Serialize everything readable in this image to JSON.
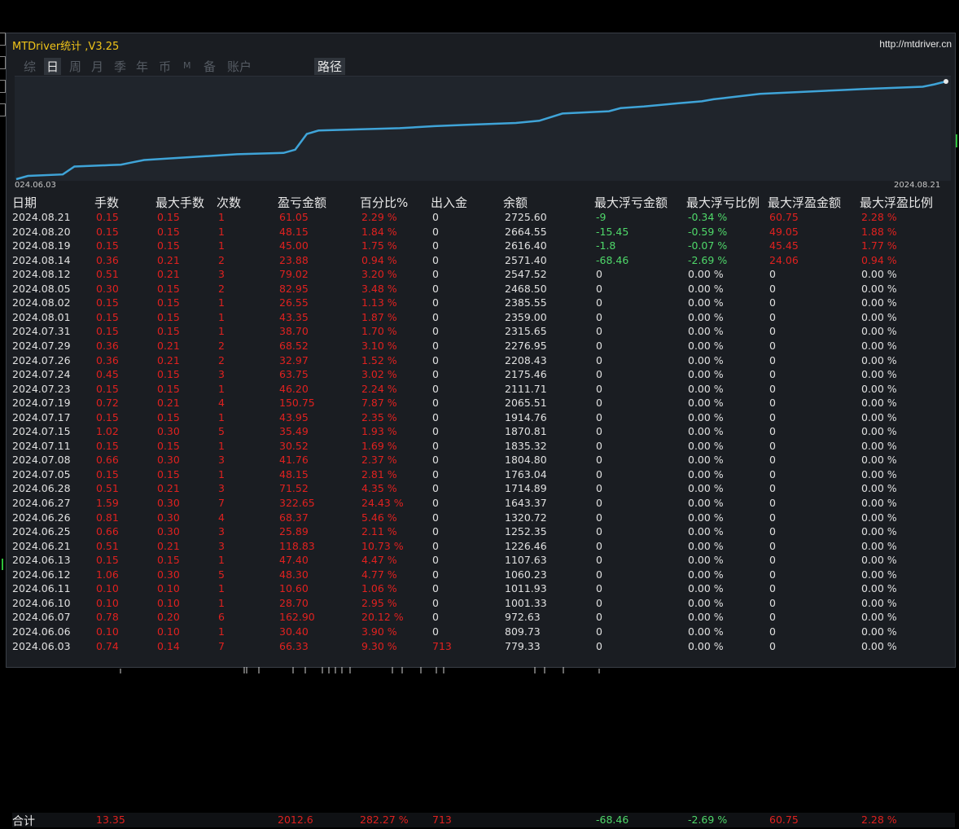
{
  "app": {
    "title": "MTDriver统计 ,V3.25",
    "url": "http://mtdriver.cn"
  },
  "tabs": [
    "综",
    "日",
    "周",
    "月",
    "季",
    "年",
    "币",
    "M",
    "备",
    "账户",
    "路径"
  ],
  "active_tab": "日",
  "chart": {
    "start_date": "024.06.03",
    "end_date": "2024.08.21",
    "line_color": "#3fa4d8"
  },
  "columns": [
    "日期",
    "手数",
    "最大手数",
    "次数",
    "盈亏金额",
    "百分比%",
    "出入金",
    "余额",
    "最大浮亏金额",
    "最大浮亏比例",
    "最大浮盈金额",
    "最大浮盈比例"
  ],
  "rows": [
    [
      "2024.08.21",
      "0.15",
      "0.15",
      "1",
      "61.05",
      "2.29 %",
      "0",
      "2725.60",
      "-9",
      "-0.34 %",
      "60.75",
      "2.28 %"
    ],
    [
      "2024.08.20",
      "0.15",
      "0.15",
      "1",
      "48.15",
      "1.84 %",
      "0",
      "2664.55",
      "-15.45",
      "-0.59 %",
      "49.05",
      "1.88 %"
    ],
    [
      "2024.08.19",
      "0.15",
      "0.15",
      "1",
      "45.00",
      "1.75 %",
      "0",
      "2616.40",
      "-1.8",
      "-0.07 %",
      "45.45",
      "1.77 %"
    ],
    [
      "2024.08.14",
      "0.36",
      "0.21",
      "2",
      "23.88",
      "0.94 %",
      "0",
      "2571.40",
      "-68.46",
      "-2.69 %",
      "24.06",
      "0.94 %"
    ],
    [
      "2024.08.12",
      "0.51",
      "0.21",
      "3",
      "79.02",
      "3.20 %",
      "0",
      "2547.52",
      "0",
      "0.00 %",
      "0",
      "0.00 %"
    ],
    [
      "2024.08.05",
      "0.30",
      "0.15",
      "2",
      "82.95",
      "3.48 %",
      "0",
      "2468.50",
      "0",
      "0.00 %",
      "0",
      "0.00 %"
    ],
    [
      "2024.08.02",
      "0.15",
      "0.15",
      "1",
      "26.55",
      "1.13 %",
      "0",
      "2385.55",
      "0",
      "0.00 %",
      "0",
      "0.00 %"
    ],
    [
      "2024.08.01",
      "0.15",
      "0.15",
      "1",
      "43.35",
      "1.87 %",
      "0",
      "2359.00",
      "0",
      "0.00 %",
      "0",
      "0.00 %"
    ],
    [
      "2024.07.31",
      "0.15",
      "0.15",
      "1",
      "38.70",
      "1.70 %",
      "0",
      "2315.65",
      "0",
      "0.00 %",
      "0",
      "0.00 %"
    ],
    [
      "2024.07.29",
      "0.36",
      "0.21",
      "2",
      "68.52",
      "3.10 %",
      "0",
      "2276.95",
      "0",
      "0.00 %",
      "0",
      "0.00 %"
    ],
    [
      "2024.07.26",
      "0.36",
      "0.21",
      "2",
      "32.97",
      "1.52 %",
      "0",
      "2208.43",
      "0",
      "0.00 %",
      "0",
      "0.00 %"
    ],
    [
      "2024.07.24",
      "0.45",
      "0.15",
      "3",
      "63.75",
      "3.02 %",
      "0",
      "2175.46",
      "0",
      "0.00 %",
      "0",
      "0.00 %"
    ],
    [
      "2024.07.23",
      "0.15",
      "0.15",
      "1",
      "46.20",
      "2.24 %",
      "0",
      "2111.71",
      "0",
      "0.00 %",
      "0",
      "0.00 %"
    ],
    [
      "2024.07.19",
      "0.72",
      "0.21",
      "4",
      "150.75",
      "7.87 %",
      "0",
      "2065.51",
      "0",
      "0.00 %",
      "0",
      "0.00 %"
    ],
    [
      "2024.07.17",
      "0.15",
      "0.15",
      "1",
      "43.95",
      "2.35 %",
      "0",
      "1914.76",
      "0",
      "0.00 %",
      "0",
      "0.00 %"
    ],
    [
      "2024.07.15",
      "1.02",
      "0.30",
      "5",
      "35.49",
      "1.93 %",
      "0",
      "1870.81",
      "0",
      "0.00 %",
      "0",
      "0.00 %"
    ],
    [
      "2024.07.11",
      "0.15",
      "0.15",
      "1",
      "30.52",
      "1.69 %",
      "0",
      "1835.32",
      "0",
      "0.00 %",
      "0",
      "0.00 %"
    ],
    [
      "2024.07.08",
      "0.66",
      "0.30",
      "3",
      "41.76",
      "2.37 %",
      "0",
      "1804.80",
      "0",
      "0.00 %",
      "0",
      "0.00 %"
    ],
    [
      "2024.07.05",
      "0.15",
      "0.15",
      "1",
      "48.15",
      "2.81 %",
      "0",
      "1763.04",
      "0",
      "0.00 %",
      "0",
      "0.00 %"
    ],
    [
      "2024.06.28",
      "0.51",
      "0.21",
      "3",
      "71.52",
      "4.35 %",
      "0",
      "1714.89",
      "0",
      "0.00 %",
      "0",
      "0.00 %"
    ],
    [
      "2024.06.27",
      "1.59",
      "0.30",
      "7",
      "322.65",
      "24.43 %",
      "0",
      "1643.37",
      "0",
      "0.00 %",
      "0",
      "0.00 %"
    ],
    [
      "2024.06.26",
      "0.81",
      "0.30",
      "4",
      "68.37",
      "5.46 %",
      "0",
      "1320.72",
      "0",
      "0.00 %",
      "0",
      "0.00 %"
    ],
    [
      "2024.06.25",
      "0.66",
      "0.30",
      "3",
      "25.89",
      "2.11 %",
      "0",
      "1252.35",
      "0",
      "0.00 %",
      "0",
      "0.00 %"
    ],
    [
      "2024.06.21",
      "0.51",
      "0.21",
      "3",
      "118.83",
      "10.73 %",
      "0",
      "1226.46",
      "0",
      "0.00 %",
      "0",
      "0.00 %"
    ],
    [
      "2024.06.13",
      "0.15",
      "0.15",
      "1",
      "47.40",
      "4.47 %",
      "0",
      "1107.63",
      "0",
      "0.00 %",
      "0",
      "0.00 %"
    ],
    [
      "2024.06.12",
      "1.06",
      "0.30",
      "5",
      "48.30",
      "4.77 %",
      "0",
      "1060.23",
      "0",
      "0.00 %",
      "0",
      "0.00 %"
    ],
    [
      "2024.06.11",
      "0.10",
      "0.10",
      "1",
      "10.60",
      "1.06 %",
      "0",
      "1011.93",
      "0",
      "0.00 %",
      "0",
      "0.00 %"
    ],
    [
      "2024.06.10",
      "0.10",
      "0.10",
      "1",
      "28.70",
      "2.95 %",
      "0",
      "1001.33",
      "0",
      "0.00 %",
      "0",
      "0.00 %"
    ],
    [
      "2024.06.07",
      "0.78",
      "0.20",
      "6",
      "162.90",
      "20.12 %",
      "0",
      "972.63",
      "0",
      "0.00 %",
      "0",
      "0.00 %"
    ],
    [
      "2024.06.06",
      "0.10",
      "0.10",
      "1",
      "30.40",
      "3.90 %",
      "0",
      "809.73",
      "0",
      "0.00 %",
      "0",
      "0.00 %"
    ],
    [
      "2024.06.03",
      "0.74",
      "0.14",
      "7",
      "66.33",
      "9.30 %",
      "713",
      "779.33",
      "0",
      "0.00 %",
      "0",
      "0.00 %"
    ]
  ],
  "total": {
    "label": "合计",
    "lots": "13.35",
    "pnl": "2012.6",
    "pct": "282.27 %",
    "cash": "713",
    "max_float_loss": "-68.46",
    "max_float_loss_pct": "-2.69 %",
    "max_float_profit": "60.75",
    "max_float_profit_pct": "2.28 %"
  },
  "colors": {
    "loss": "#4fd86a",
    "profit": "#e0211f",
    "neutral": "#e0e0e0",
    "title": "#f0c419"
  }
}
